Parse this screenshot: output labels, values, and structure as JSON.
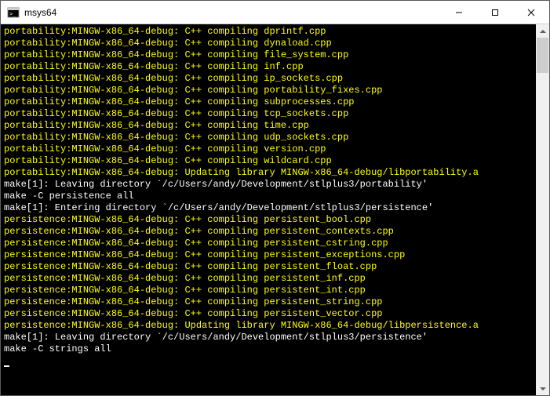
{
  "window": {
    "title": "msys64"
  },
  "terminal": {
    "lines": [
      {
        "text": "portability:MINGW-x86_64-debug: C++ compiling dprintf.cpp",
        "yellow": true
      },
      {
        "text": "portability:MINGW-x86_64-debug: C++ compiling dynaload.cpp",
        "yellow": true
      },
      {
        "text": "portability:MINGW-x86_64-debug: C++ compiling file_system.cpp",
        "yellow": true
      },
      {
        "text": "portability:MINGW-x86_64-debug: C++ compiling inf.cpp",
        "yellow": true
      },
      {
        "text": "portability:MINGW-x86_64-debug: C++ compiling ip_sockets.cpp",
        "yellow": true
      },
      {
        "text": "portability:MINGW-x86_64-debug: C++ compiling portability_fixes.cpp",
        "yellow": true
      },
      {
        "text": "portability:MINGW-x86_64-debug: C++ compiling subprocesses.cpp",
        "yellow": true
      },
      {
        "text": "portability:MINGW-x86_64-debug: C++ compiling tcp_sockets.cpp",
        "yellow": true
      },
      {
        "text": "portability:MINGW-x86_64-debug: C++ compiling time.cpp",
        "yellow": true
      },
      {
        "text": "portability:MINGW-x86_64-debug: C++ compiling udp_sockets.cpp",
        "yellow": true
      },
      {
        "text": "portability:MINGW-x86_64-debug: C++ compiling version.cpp",
        "yellow": true
      },
      {
        "text": "portability:MINGW-x86_64-debug: C++ compiling wildcard.cpp",
        "yellow": true
      },
      {
        "text": "portability:MINGW-x86_64-debug: Updating library MINGW-x86_64-debug/libportability.a",
        "yellow": true
      },
      {
        "text": "make[1]: Leaving directory `/c/Users/andy/Development/stlplus3/portability'",
        "yellow": false
      },
      {
        "text": "make -C persistence all",
        "yellow": false
      },
      {
        "text": "make[1]: Entering directory `/c/Users/andy/Development/stlplus3/persistence'",
        "yellow": false
      },
      {
        "text": "persistence:MINGW-x86_64-debug: C++ compiling persistent_bool.cpp",
        "yellow": true
      },
      {
        "text": "persistence:MINGW-x86_64-debug: C++ compiling persistent_contexts.cpp",
        "yellow": true
      },
      {
        "text": "persistence:MINGW-x86_64-debug: C++ compiling persistent_cstring.cpp",
        "yellow": true
      },
      {
        "text": "persistence:MINGW-x86_64-debug: C++ compiling persistent_exceptions.cpp",
        "yellow": true
      },
      {
        "text": "persistence:MINGW-x86_64-debug: C++ compiling persistent_float.cpp",
        "yellow": true
      },
      {
        "text": "persistence:MINGW-x86_64-debug: C++ compiling persistent_inf.cpp",
        "yellow": true
      },
      {
        "text": "persistence:MINGW-x86_64-debug: C++ compiling persistent_int.cpp",
        "yellow": true
      },
      {
        "text": "persistence:MINGW-x86_64-debug: C++ compiling persistent_string.cpp",
        "yellow": true
      },
      {
        "text": "persistence:MINGW-x86_64-debug: C++ compiling persistent_vector.cpp",
        "yellow": true
      },
      {
        "text": "persistence:MINGW-x86_64-debug: Updating library MINGW-x86_64-debug/libpersistence.a",
        "yellow": true
      },
      {
        "text": "make[1]: Leaving directory `/c/Users/andy/Development/stlplus3/persistence'",
        "yellow": false
      },
      {
        "text": "make -C strings all",
        "yellow": false
      }
    ]
  }
}
